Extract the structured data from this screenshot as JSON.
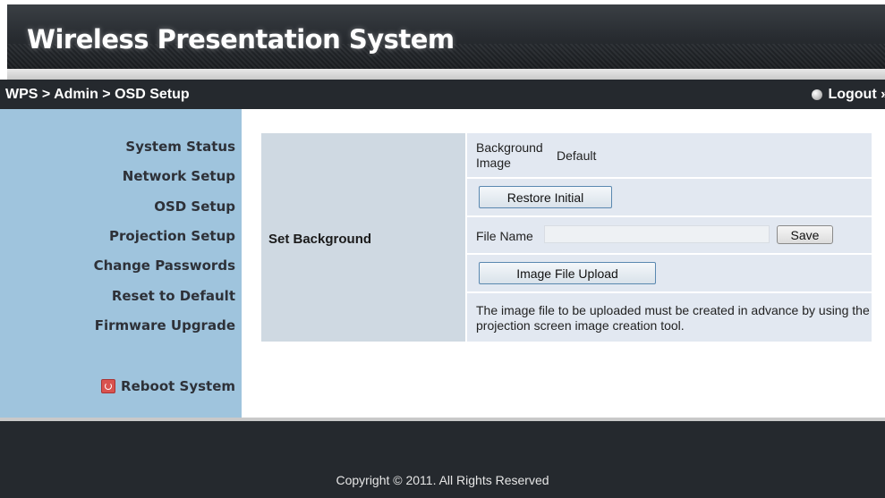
{
  "header": {
    "title": "Wireless Presentation System"
  },
  "breadcrumb": "WPS > Admin > OSD Setup",
  "logout_label": "Logout »",
  "sidebar": {
    "items": [
      {
        "label": "System Status"
      },
      {
        "label": "Network Setup"
      },
      {
        "label": "OSD Setup"
      },
      {
        "label": "Projection Setup"
      },
      {
        "label": "Change Passwords"
      },
      {
        "label": "Reset to Default"
      },
      {
        "label": "Firmware Upgrade"
      }
    ],
    "reboot_label": "Reboot System"
  },
  "main": {
    "section_label": "Set Background",
    "background_image_label": "Background Image",
    "background_image_value": "Default",
    "restore_button": "Restore Initial",
    "file_name_label": "File Name",
    "file_name_value": "",
    "save_button": "Save",
    "upload_button": "Image File Upload",
    "note": "The image file to be uploaded must be created in advance by using the projection screen image creation tool."
  },
  "footer": {
    "copyright": "Copyright © 2011. All Rights Reserved"
  },
  "colors": {
    "sidebar_bg": "#9fc4dd",
    "header_bar": "#25292e",
    "table_left": "#cfd9e2",
    "table_row": "#e2e8f1"
  },
  "icons": {
    "logout": "bullet-dot-icon",
    "reboot": "power-icon"
  }
}
